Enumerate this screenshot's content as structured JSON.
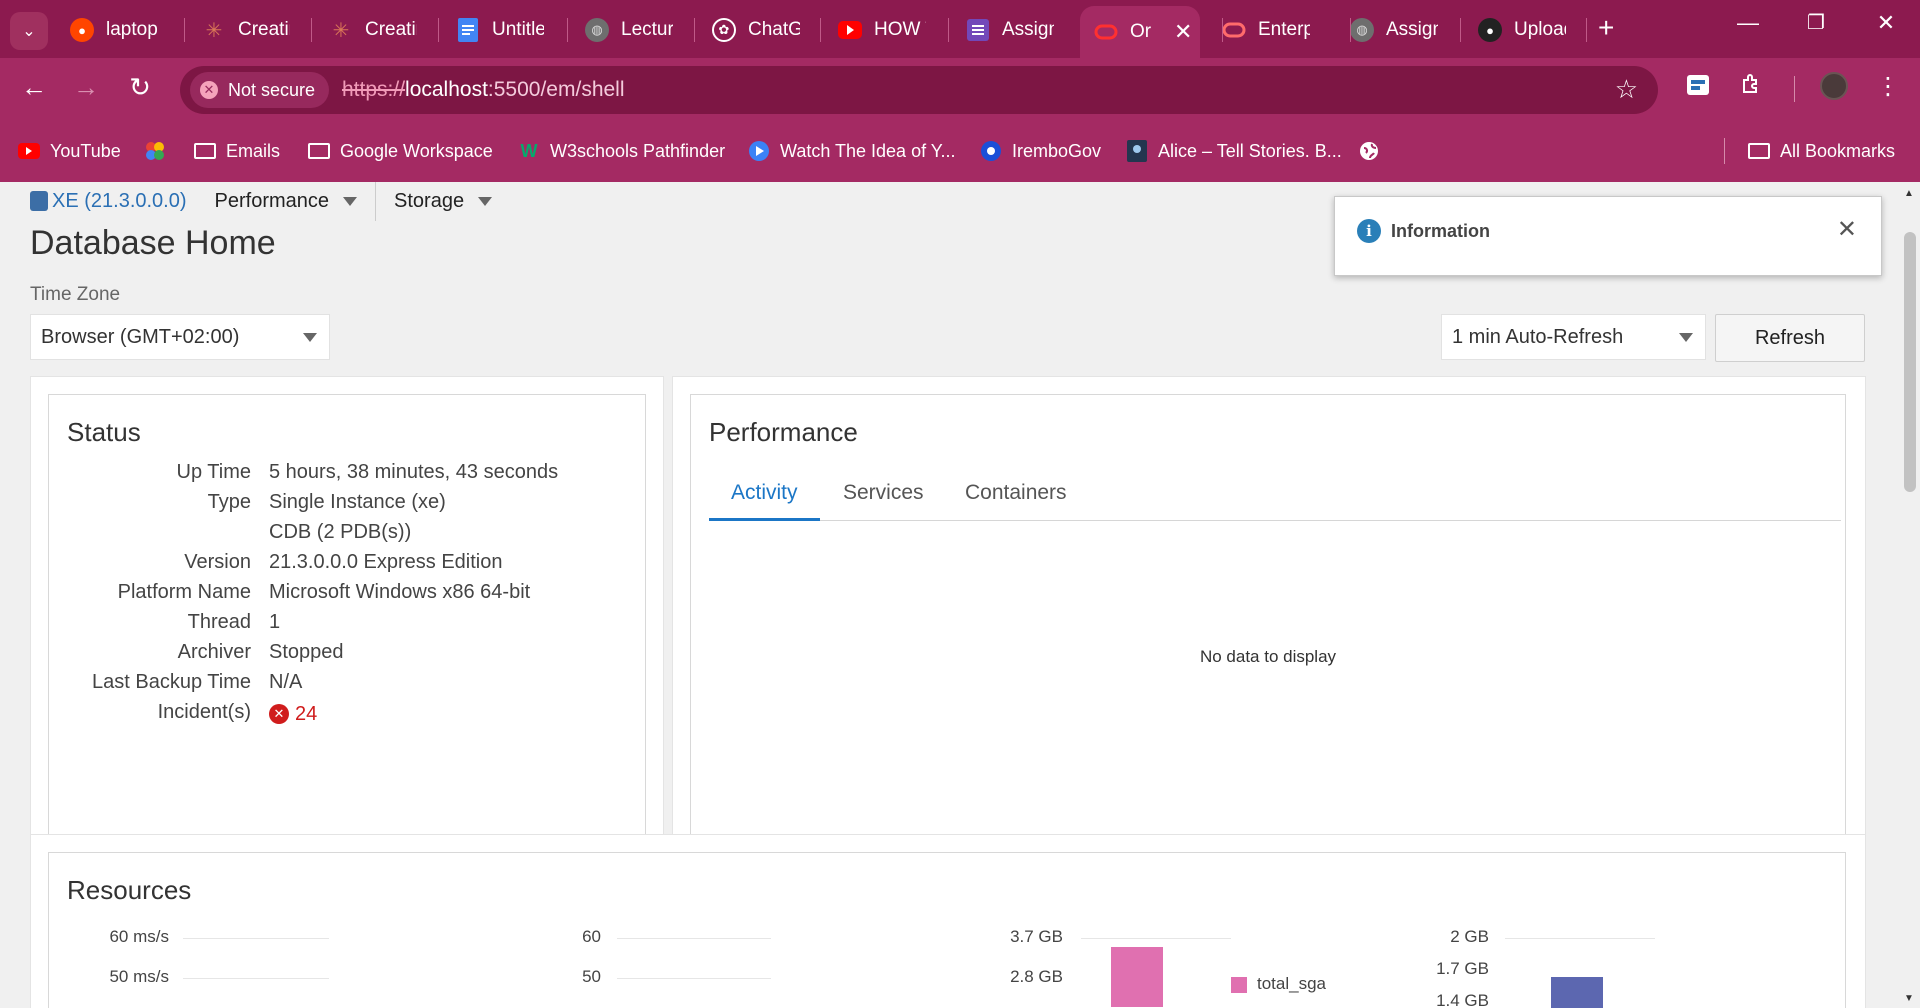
{
  "browser": {
    "tabs": [
      {
        "label": "laptop",
        "icon": "reddit-icon",
        "color": "#ff4500"
      },
      {
        "label": "Creatin",
        "icon": "claude-icon",
        "color": "#d97757"
      },
      {
        "label": "Creatin",
        "icon": "claude-icon",
        "color": "#d97757"
      },
      {
        "label": "Untitled",
        "icon": "docs-icon",
        "color": "#4285f4"
      },
      {
        "label": "Lecture",
        "icon": "globe-icon",
        "color": "#777777"
      },
      {
        "label": "ChatGPT",
        "icon": "chatgpt-icon",
        "color": "#ffffff"
      },
      {
        "label": "HOW T",
        "icon": "youtube-icon",
        "color": "#ff0000"
      },
      {
        "label": "Assignm",
        "icon": "forms-icon",
        "color": "#7248b9"
      },
      {
        "label": "Or",
        "icon": "oracle-icon",
        "color": "#f80000"
      },
      {
        "label": "Enterpr",
        "icon": "oracle-icon",
        "color": "#f80000"
      },
      {
        "label": "Assignm",
        "icon": "globe-icon",
        "color": "#777777"
      },
      {
        "label": "Upload",
        "icon": "github-icon",
        "color": "#222222"
      }
    ],
    "active_tab_index": 8,
    "security": "Not secure",
    "url_scheme": "https://",
    "url_host": "localhost",
    "url_rest": ":5500/em/shell",
    "bookmarks": [
      {
        "label": "YouTube",
        "icon": "youtube-icon"
      },
      {
        "label": "",
        "icon": "photos-icon"
      },
      {
        "label": "Emails",
        "icon": "folder-icon"
      },
      {
        "label": "Google Workspace",
        "icon": "folder-icon"
      },
      {
        "label": "W3schools Pathfinder",
        "icon": "w3schools-icon"
      },
      {
        "label": "Watch The Idea of Y...",
        "icon": "play-icon"
      },
      {
        "label": "IremboGov",
        "icon": "irembo-icon"
      },
      {
        "label": "Alice – Tell Stories. B...",
        "icon": "alice-icon"
      },
      {
        "label": "",
        "icon": "globe-icon"
      }
    ],
    "all_bookmarks": "All Bookmarks"
  },
  "nav": {
    "db": "XE (21.3.0.0.0)",
    "performance": "Performance",
    "storage": "Storage"
  },
  "page": {
    "title": "Database Home",
    "time_zone_label": "Time Zone",
    "time_zone_value": "Browser (GMT+02:00)",
    "auto_refresh": "1 min Auto-Refresh",
    "refresh": "Refresh"
  },
  "info_popup": {
    "title": "Information"
  },
  "status": {
    "title": "Status",
    "rows": [
      {
        "key": "Up Time",
        "value": "5 hours, 38 minutes, 43 seconds"
      },
      {
        "key": "Type",
        "value": "Single Instance (xe)"
      },
      {
        "key": "",
        "value": "CDB (2 PDB(s))"
      },
      {
        "key": "Version",
        "value": "21.3.0.0.0 Express Edition"
      },
      {
        "key": "Platform Name",
        "value": "Microsoft Windows x86 64-bit"
      },
      {
        "key": "Thread",
        "value": "1"
      },
      {
        "key": "Archiver",
        "value": "Stopped"
      },
      {
        "key": "Last Backup Time",
        "value": "N/A"
      }
    ],
    "incidents_label": "Incident(s)",
    "incidents_value": "24"
  },
  "performance": {
    "title": "Performance",
    "tabs": [
      "Activity",
      "Services",
      "Containers"
    ],
    "active_tab": "Activity",
    "empty_message": "No data to display"
  },
  "resources": {
    "title": "Resources",
    "chart1_ticks": [
      "60 ms/s",
      "50 ms/s"
    ],
    "chart2_ticks": [
      "60",
      "50"
    ],
    "chart3_ticks": [
      "3.7 GB",
      "2.8 GB"
    ],
    "chart3_legend": "total_sga",
    "chart3_color": "#e070b0",
    "chart4_ticks": [
      "2 GB",
      "1.7 GB",
      "1.4 GB"
    ],
    "chart4_color": "#5c67b0"
  }
}
